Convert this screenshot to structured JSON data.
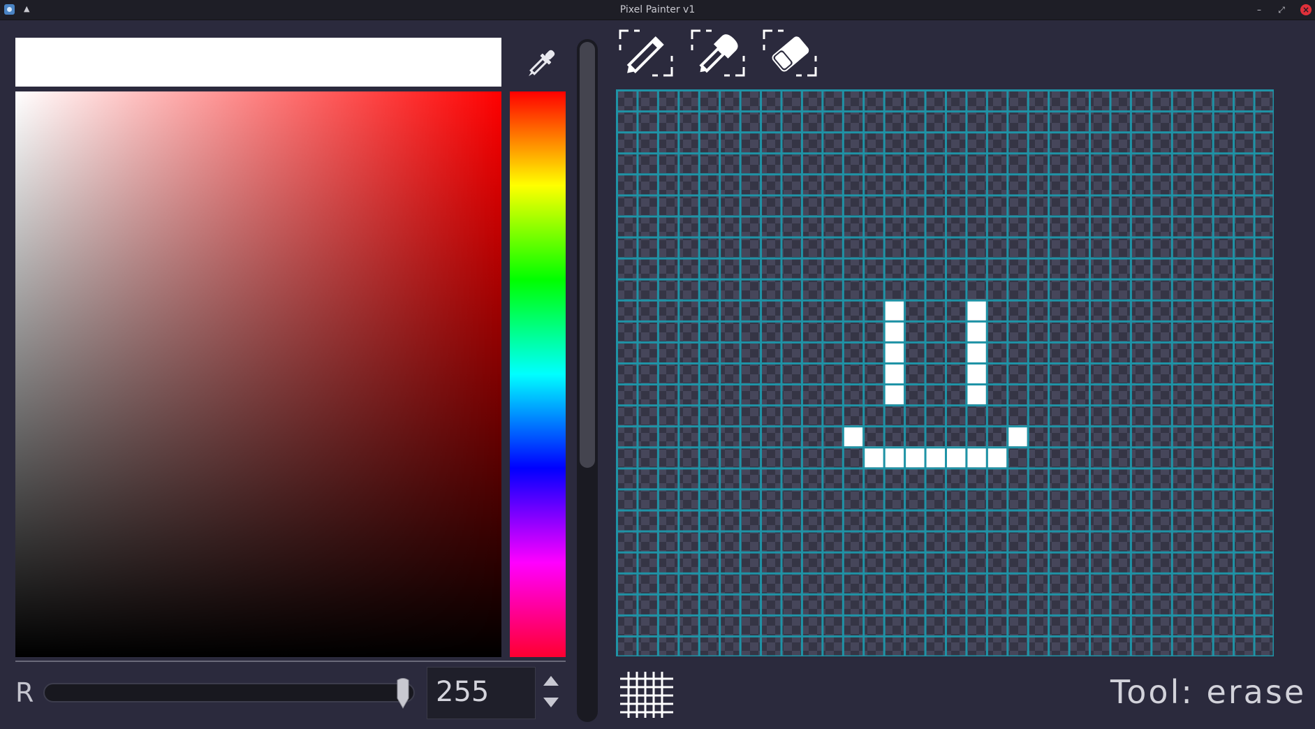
{
  "window": {
    "title": "Pixel Painter v1"
  },
  "color_picker": {
    "current_color": "#ffffff",
    "base_hue_color": "#ff0000",
    "channel_label": "R",
    "channel_value": "255",
    "channel_level": 1.0
  },
  "tools": [
    {
      "name": "pencil",
      "icon": "pencil-icon"
    },
    {
      "name": "fill",
      "icon": "bucket-icon"
    },
    {
      "name": "erase",
      "icon": "eraser-icon"
    }
  ],
  "canvas": {
    "cols": 32,
    "rows": 27,
    "grid_color": "#1f93a6",
    "pixel_color": "#ffffff",
    "pixels": [
      [
        13,
        10
      ],
      [
        13,
        11
      ],
      [
        13,
        12
      ],
      [
        13,
        13
      ],
      [
        13,
        14
      ],
      [
        17,
        10
      ],
      [
        17,
        11
      ],
      [
        17,
        12
      ],
      [
        17,
        13
      ],
      [
        17,
        14
      ],
      [
        11,
        16
      ],
      [
        19,
        16
      ],
      [
        12,
        17
      ],
      [
        13,
        17
      ],
      [
        14,
        17
      ],
      [
        15,
        17
      ],
      [
        16,
        17
      ],
      [
        17,
        17
      ],
      [
        18,
        17
      ]
    ]
  },
  "status": {
    "tool_text": "Tool: erase"
  }
}
